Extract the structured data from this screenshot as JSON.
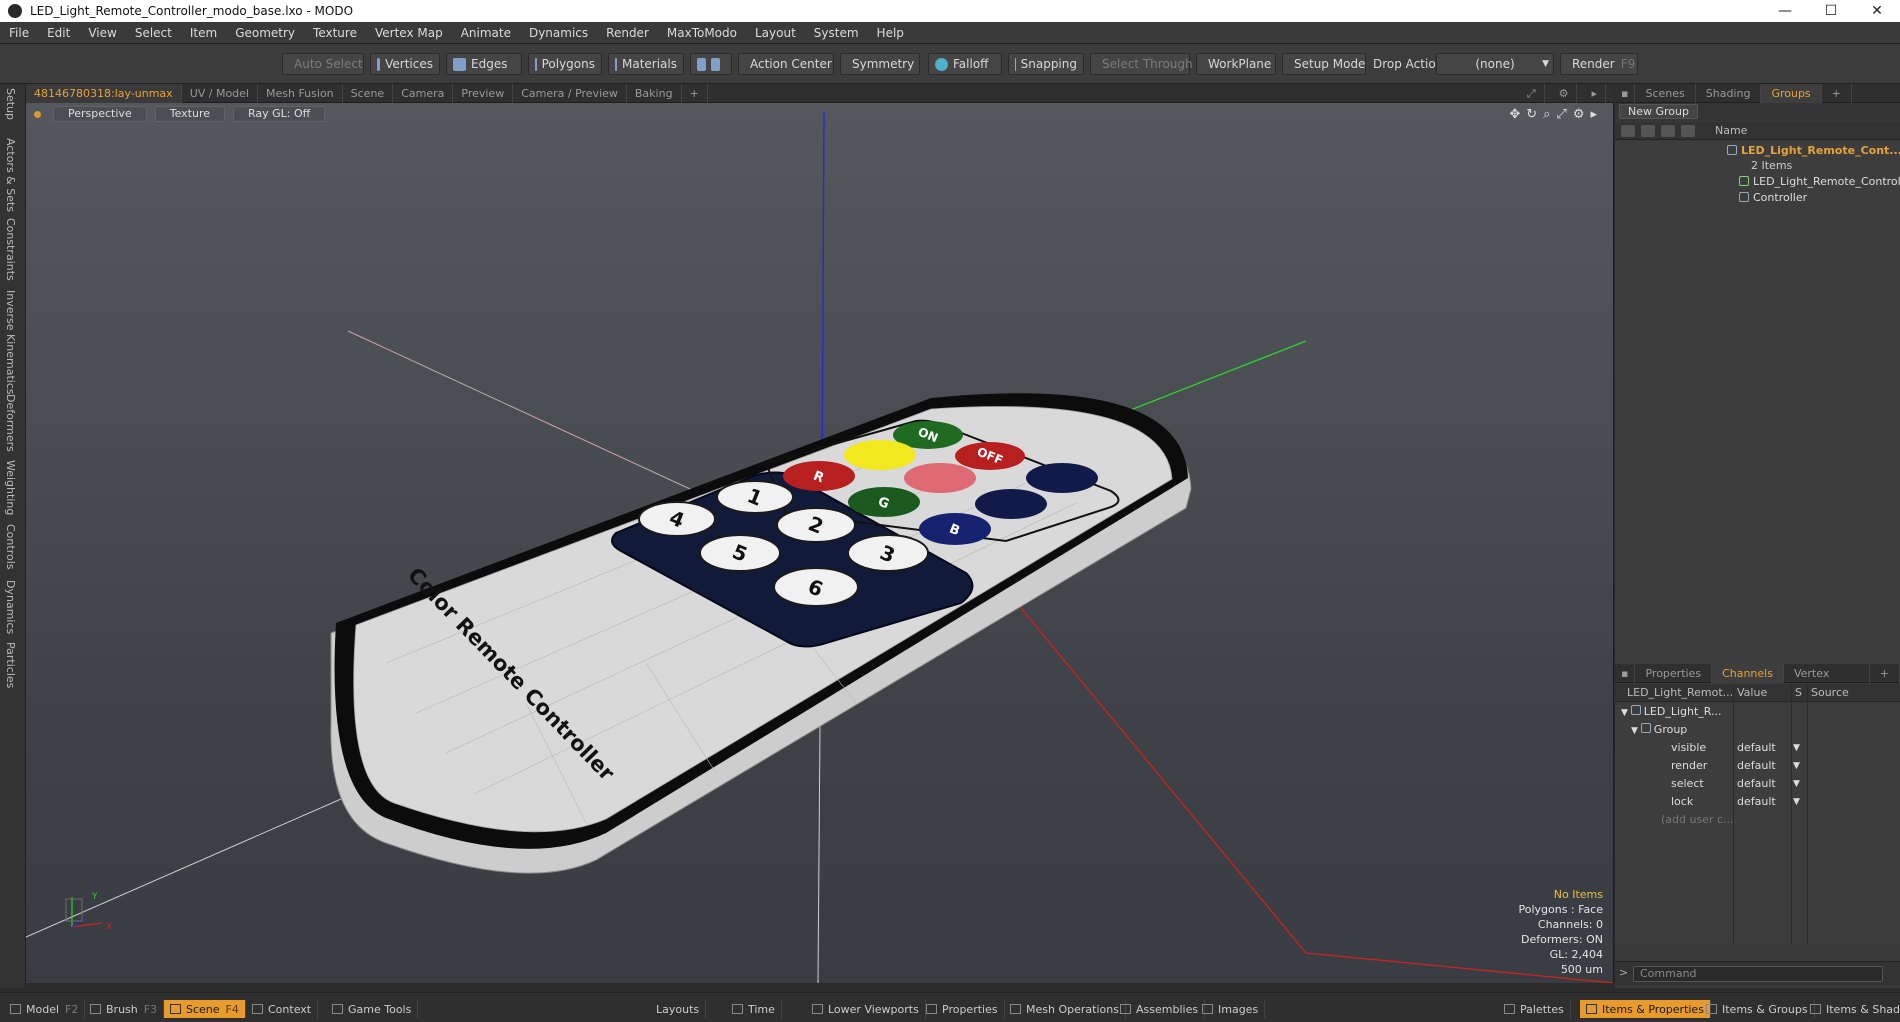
{
  "window": {
    "title": "LED_Light_Remote_Controller_modo_base.lxo - MODO",
    "controls": [
      "—",
      "☐",
      "✕"
    ]
  },
  "menu": [
    "File",
    "Edit",
    "View",
    "Select",
    "Item",
    "Geometry",
    "Texture",
    "Vertex Map",
    "Animate",
    "Dynamics",
    "Render",
    "MaxToModo",
    "Layout",
    "System",
    "Help"
  ],
  "toolbar": {
    "auto_select": "Auto Select",
    "vertices": "Vertices",
    "edges": "Edges",
    "polygons": "Polygons",
    "materials": "Materials",
    "action_center": "Action Center",
    "symmetry": "Symmetry",
    "falloff": "Falloff",
    "snapping": "Snapping",
    "select_through": "Select Through",
    "workplane": "WorkPlane",
    "setup_mode": "Setup Mode",
    "drop_action": "Drop Action",
    "drop_value": "(none)",
    "render": "Render",
    "render_key": "F9"
  },
  "left_tabs": [
    "Setup",
    "Actors & Sets",
    "Constraints",
    "Inverse Kinematics",
    "Deformers",
    "Weighting",
    "Controls",
    "Dynamics",
    "Particles"
  ],
  "viewport_tabs": [
    "48146780318:lay-unmax",
    "UV / Model",
    "Mesh Fusion",
    "Scene",
    "Camera",
    "Preview",
    "Camera / Preview",
    "Baking",
    "+"
  ],
  "viewport": {
    "view": "Perspective",
    "shading": "Texture",
    "raygl": "Ray GL: Off",
    "model_text": "Color Remote Controller",
    "buttons": [
      "ON",
      "OFF",
      "R",
      "G",
      "B",
      "1",
      "2",
      "3",
      "4",
      "5",
      "6"
    ],
    "colors": {
      "green": "#1f6b22",
      "red": "#b81f1f",
      "yellow": "#f2e81e",
      "pink": "#e06a74",
      "navy": "#121a4a",
      "darkgreen": "#1a5a1e",
      "darkred": "#9e1414",
      "blue": "#142270"
    }
  },
  "hud": {
    "items": "No Items",
    "polygons": "Polygons : Face",
    "channels": "Channels: 0",
    "deformers": "Deformers: ON",
    "gl": "GL: 2,404",
    "scale": "500 um"
  },
  "right_tabs_top": [
    "Scenes",
    "Shading",
    "Groups",
    "+"
  ],
  "groups": {
    "new_group": "New Group",
    "col_name": "Name",
    "root": "LED_Light_Remote_Cont...",
    "root_count": "2 Items",
    "child1": "LED_Light_Remote_Controller",
    "child2": "Controller"
  },
  "right_tabs_bottom": [
    "Properties",
    "Channels",
    "Vertex Maps",
    "+"
  ],
  "channels": {
    "col_item": "LED_Light_Remot...",
    "col_value": "Value",
    "col_s": "S",
    "col_source": "Source",
    "item": "LED_Light_R...",
    "group": "Group",
    "rows": [
      {
        "name": "visible",
        "value": "default"
      },
      {
        "name": "render",
        "value": "default"
      },
      {
        "name": "select",
        "value": "default"
      },
      {
        "name": "lock",
        "value": "default"
      }
    ],
    "add_user": "(add user c..."
  },
  "command_placeholder": "Command",
  "statusbar": {
    "model": "Model",
    "model_key": "F2",
    "brush": "Brush",
    "brush_key": "F3",
    "scene": "Scene",
    "scene_key": "F4",
    "context": "Context",
    "game_tools": "Game Tools",
    "layouts": "Layouts",
    "time": "Time",
    "lower_viewports": "Lower Viewports",
    "properties": "Properties",
    "mesh_operations": "Mesh Operations",
    "assemblies": "Assemblies",
    "images": "Images",
    "palettes": "Palettes",
    "items_properties": "Items & Properties",
    "items_groups": "Items & Groups",
    "items_shading": "Items & Shadin"
  }
}
